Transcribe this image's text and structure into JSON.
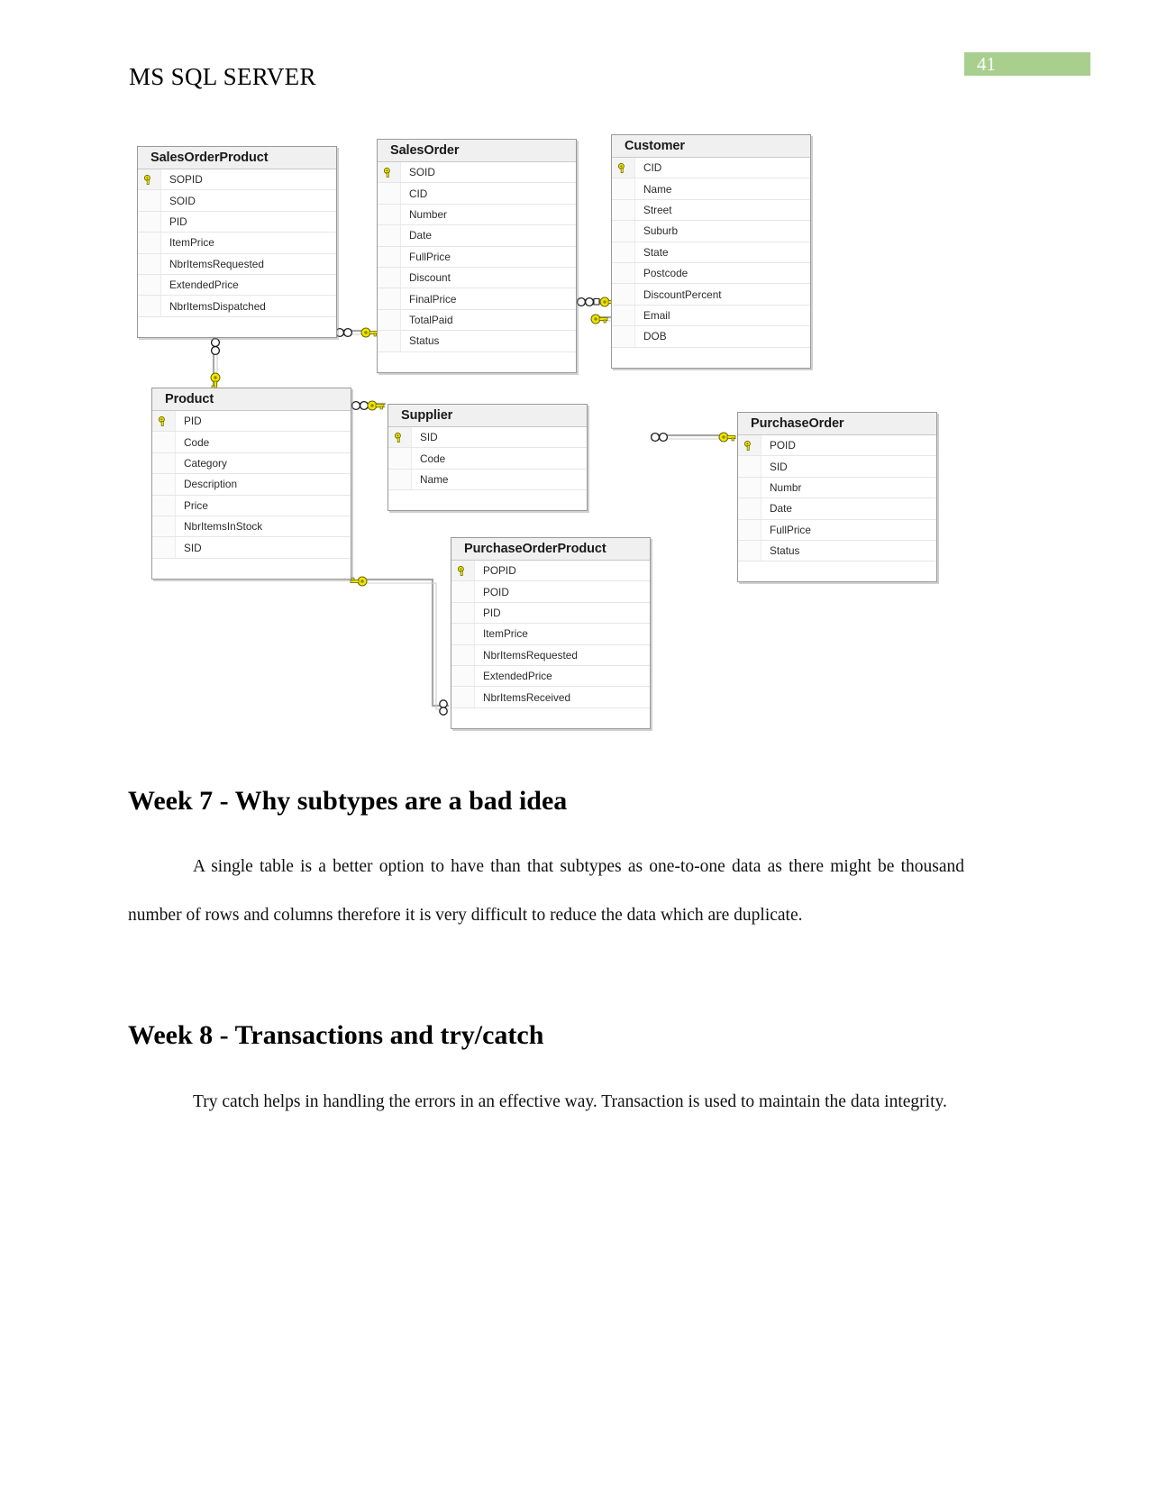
{
  "header": {
    "doc_title": "MS SQL SERVER",
    "page_number": "41",
    "page_number_bg": "#a9cf8f"
  },
  "diagram": {
    "name": "entity-relationship-diagram",
    "key_icon": "key-icon",
    "crowsfoot_icon": "crowsfoot-icon",
    "tables": [
      {
        "name": "SalesOrderProduct",
        "fields": [
          {
            "label": "SOPID",
            "pk": true
          },
          {
            "label": "SOID",
            "pk": false
          },
          {
            "label": "PID",
            "pk": false
          },
          {
            "label": "ItemPrice",
            "pk": false
          },
          {
            "label": "NbrItemsRequested",
            "pk": false
          },
          {
            "label": "ExtendedPrice",
            "pk": false
          },
          {
            "label": "NbrItemsDispatched",
            "pk": false
          }
        ]
      },
      {
        "name": "SalesOrder",
        "fields": [
          {
            "label": "SOID",
            "pk": true
          },
          {
            "label": "CID",
            "pk": false
          },
          {
            "label": "Number",
            "pk": false
          },
          {
            "label": "Date",
            "pk": false
          },
          {
            "label": "FullPrice",
            "pk": false
          },
          {
            "label": "Discount",
            "pk": false
          },
          {
            "label": "FinalPrice",
            "pk": false
          },
          {
            "label": "TotalPaid",
            "pk": false
          },
          {
            "label": "Status",
            "pk": false
          }
        ]
      },
      {
        "name": "Customer",
        "fields": [
          {
            "label": "CID",
            "pk": true
          },
          {
            "label": "Name",
            "pk": false
          },
          {
            "label": "Street",
            "pk": false
          },
          {
            "label": "Suburb",
            "pk": false
          },
          {
            "label": "State",
            "pk": false
          },
          {
            "label": "Postcode",
            "pk": false
          },
          {
            "label": "DiscountPercent",
            "pk": false
          },
          {
            "label": "Email",
            "pk": false
          },
          {
            "label": "DOB",
            "pk": false
          }
        ]
      },
      {
        "name": "Product",
        "fields": [
          {
            "label": "PID",
            "pk": true
          },
          {
            "label": "Code",
            "pk": false
          },
          {
            "label": "Category",
            "pk": false
          },
          {
            "label": "Description",
            "pk": false
          },
          {
            "label": "Price",
            "pk": false
          },
          {
            "label": "NbrItemsInStock",
            "pk": false
          },
          {
            "label": "SID",
            "pk": false
          }
        ]
      },
      {
        "name": "Supplier",
        "fields": [
          {
            "label": "SID",
            "pk": true
          },
          {
            "label": "Code",
            "pk": false
          },
          {
            "label": "Name",
            "pk": false
          }
        ]
      },
      {
        "name": "PurchaseOrder",
        "fields": [
          {
            "label": "POID",
            "pk": true
          },
          {
            "label": "SID",
            "pk": false
          },
          {
            "label": "Numbr",
            "pk": false
          },
          {
            "label": "Date",
            "pk": false
          },
          {
            "label": "FullPrice",
            "pk": false
          },
          {
            "label": "Status",
            "pk": false
          }
        ]
      },
      {
        "name": "PurchaseOrderProduct",
        "fields": [
          {
            "label": "POPID",
            "pk": true
          },
          {
            "label": "POID",
            "pk": false
          },
          {
            "label": "PID",
            "pk": false
          },
          {
            "label": "ItemPrice",
            "pk": false
          },
          {
            "label": "NbrItemsRequested",
            "pk": false
          },
          {
            "label": "ExtendedPrice",
            "pk": false
          },
          {
            "label": "NbrItemsReceived",
            "pk": false
          }
        ]
      }
    ]
  },
  "content": {
    "week7_heading": "Week 7 - Why subtypes are a bad idea",
    "week7_paragraph": "A single table is a better option to have than that subtypes as one-to-one data as there might be thousand number of rows and columns therefore it is very difficult to reduce the data which are duplicate.",
    "week8_heading": "Week 8 - Transactions and try/catch",
    "week8_paragraph": "Try catch helps in handling the errors in an effective way. Transaction is used to maintain the data integrity."
  }
}
